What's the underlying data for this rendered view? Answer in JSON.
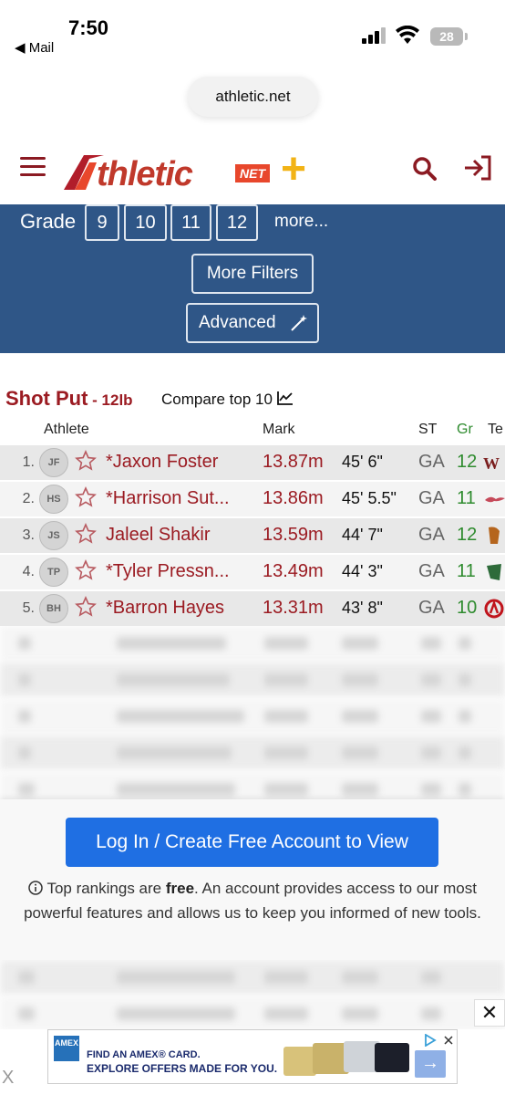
{
  "status": {
    "time": "7:50",
    "back_label": "◀ Mail",
    "battery": "28"
  },
  "browser": {
    "url": "athletic.net"
  },
  "header": {
    "logo_text": "thletic",
    "logo_net": "NET",
    "logo_plus": "+"
  },
  "filters": {
    "grade_label": "Grade",
    "grades": [
      "9",
      "10",
      "11",
      "12"
    ],
    "more": "more...",
    "more_filters": "More Filters",
    "advanced": "Advanced"
  },
  "event": {
    "name": "Shot Put",
    "weight": " - 12lb",
    "compare": "Compare top 10"
  },
  "table": {
    "headers": {
      "athlete": "Athlete",
      "mark": "Mark",
      "st": "ST",
      "gr": "Gr",
      "team": "Te"
    },
    "rows": [
      {
        "rank": "1.",
        "initials": "JF",
        "name": "*Jaxon Foster",
        "mark": "13.87m",
        "imperial": "45' 6\"",
        "state": "GA",
        "grade": "12"
      },
      {
        "rank": "2.",
        "initials": "HS",
        "name": "*Harrison Sut...",
        "mark": "13.86m",
        "imperial": "45' 5.5\"",
        "state": "GA",
        "grade": "11"
      },
      {
        "rank": "3.",
        "initials": "JS",
        "name": "Jaleel Shakir",
        "mark": "13.59m",
        "imperial": "44' 7\"",
        "state": "GA",
        "grade": "12"
      },
      {
        "rank": "4.",
        "initials": "TP",
        "name": "*Tyler Pressn...",
        "mark": "13.49m",
        "imperial": "44' 3\"",
        "state": "GA",
        "grade": "11"
      },
      {
        "rank": "5.",
        "initials": "BH",
        "name": "*Barron Hayes",
        "mark": "13.31m",
        "imperial": "43' 8\"",
        "state": "GA",
        "grade": "10"
      }
    ]
  },
  "gate": {
    "button": "Log In / Create Free Account to View",
    "info_pre": "Top rankings are ",
    "info_bold": "free",
    "info_post": ". An account provides access to our most powerful features and allows us to keep you informed of new tools."
  },
  "ad": {
    "logo": "AMEX",
    "line1": "FIND AN AMEX® CARD.",
    "line2": "EXPLORE OFFERS MADE FOR YOU.",
    "close": "✕"
  },
  "colors": {
    "brand": "#9b1b22",
    "panel": "#2f5687",
    "cta": "#1f6fe3",
    "grade_green": "#2e8b2e"
  }
}
